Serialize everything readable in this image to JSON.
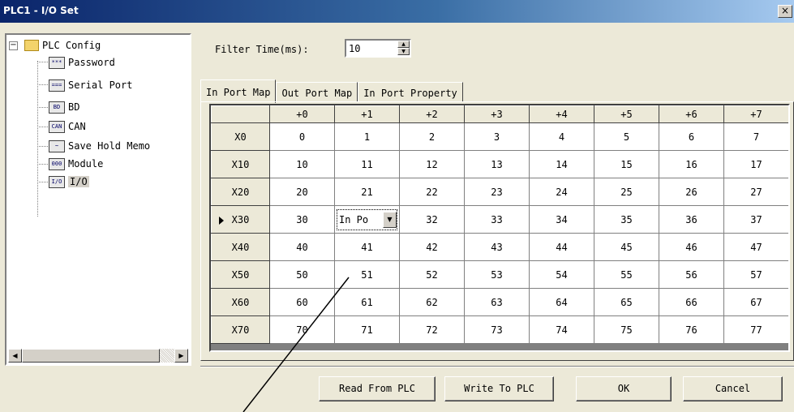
{
  "window": {
    "title": "PLC1 - I/O Set",
    "close_glyph": "×"
  },
  "tree": {
    "expander": "−",
    "root": "PLC Config",
    "items": [
      {
        "label": "Password",
        "icon": "password-icon",
        "icon_text": "***"
      },
      {
        "label": "Serial Port",
        "icon": "serial-port-icon",
        "icon_text": "==="
      },
      {
        "label": "BD",
        "icon": "bd-icon",
        "icon_text": "BD"
      },
      {
        "label": "CAN",
        "icon": "can-icon",
        "icon_text": "CAN"
      },
      {
        "label": "Save Hold Memo",
        "icon": "save-hold-icon",
        "icon_text": "~"
      },
      {
        "label": "Module",
        "icon": "module-icon",
        "icon_text": "000"
      },
      {
        "label": "I/O",
        "icon": "io-icon",
        "icon_text": "I/O"
      }
    ],
    "selected": "I/O"
  },
  "filter": {
    "label": "Filter Time(ms):",
    "value": "10"
  },
  "tabs": [
    "In Port Map",
    "Out Port Map",
    "In Port Property"
  ],
  "active_tab": "In Port Map",
  "grid": {
    "columns": [
      "+0",
      "+1",
      "+2",
      "+3",
      "+4",
      "+5",
      "+6",
      "+7"
    ],
    "rows": [
      {
        "header": "X0",
        "cells": [
          "0",
          "1",
          "2",
          "3",
          "4",
          "5",
          "6",
          "7"
        ]
      },
      {
        "header": "X10",
        "cells": [
          "10",
          "11",
          "12",
          "13",
          "14",
          "15",
          "16",
          "17"
        ]
      },
      {
        "header": "X20",
        "cells": [
          "20",
          "21",
          "22",
          "23",
          "24",
          "25",
          "26",
          "27"
        ]
      },
      {
        "header": "X30",
        "cells": [
          "30",
          "",
          "32",
          "33",
          "34",
          "35",
          "36",
          "37"
        ]
      },
      {
        "header": "X40",
        "cells": [
          "40",
          "41",
          "42",
          "43",
          "44",
          "45",
          "46",
          "47"
        ]
      },
      {
        "header": "X50",
        "cells": [
          "50",
          "51",
          "52",
          "53",
          "54",
          "55",
          "56",
          "57"
        ]
      },
      {
        "header": "X60",
        "cells": [
          "60",
          "61",
          "62",
          "63",
          "64",
          "65",
          "66",
          "67"
        ]
      },
      {
        "header": "X70",
        "cells": [
          "70",
          "71",
          "72",
          "73",
          "74",
          "75",
          "76",
          "77"
        ]
      }
    ],
    "current_row": "X30",
    "editor_text": "In Po"
  },
  "buttons": {
    "read": "Read From PLC",
    "write": "Write To PLC",
    "ok": "OK",
    "cancel": "Cancel"
  }
}
